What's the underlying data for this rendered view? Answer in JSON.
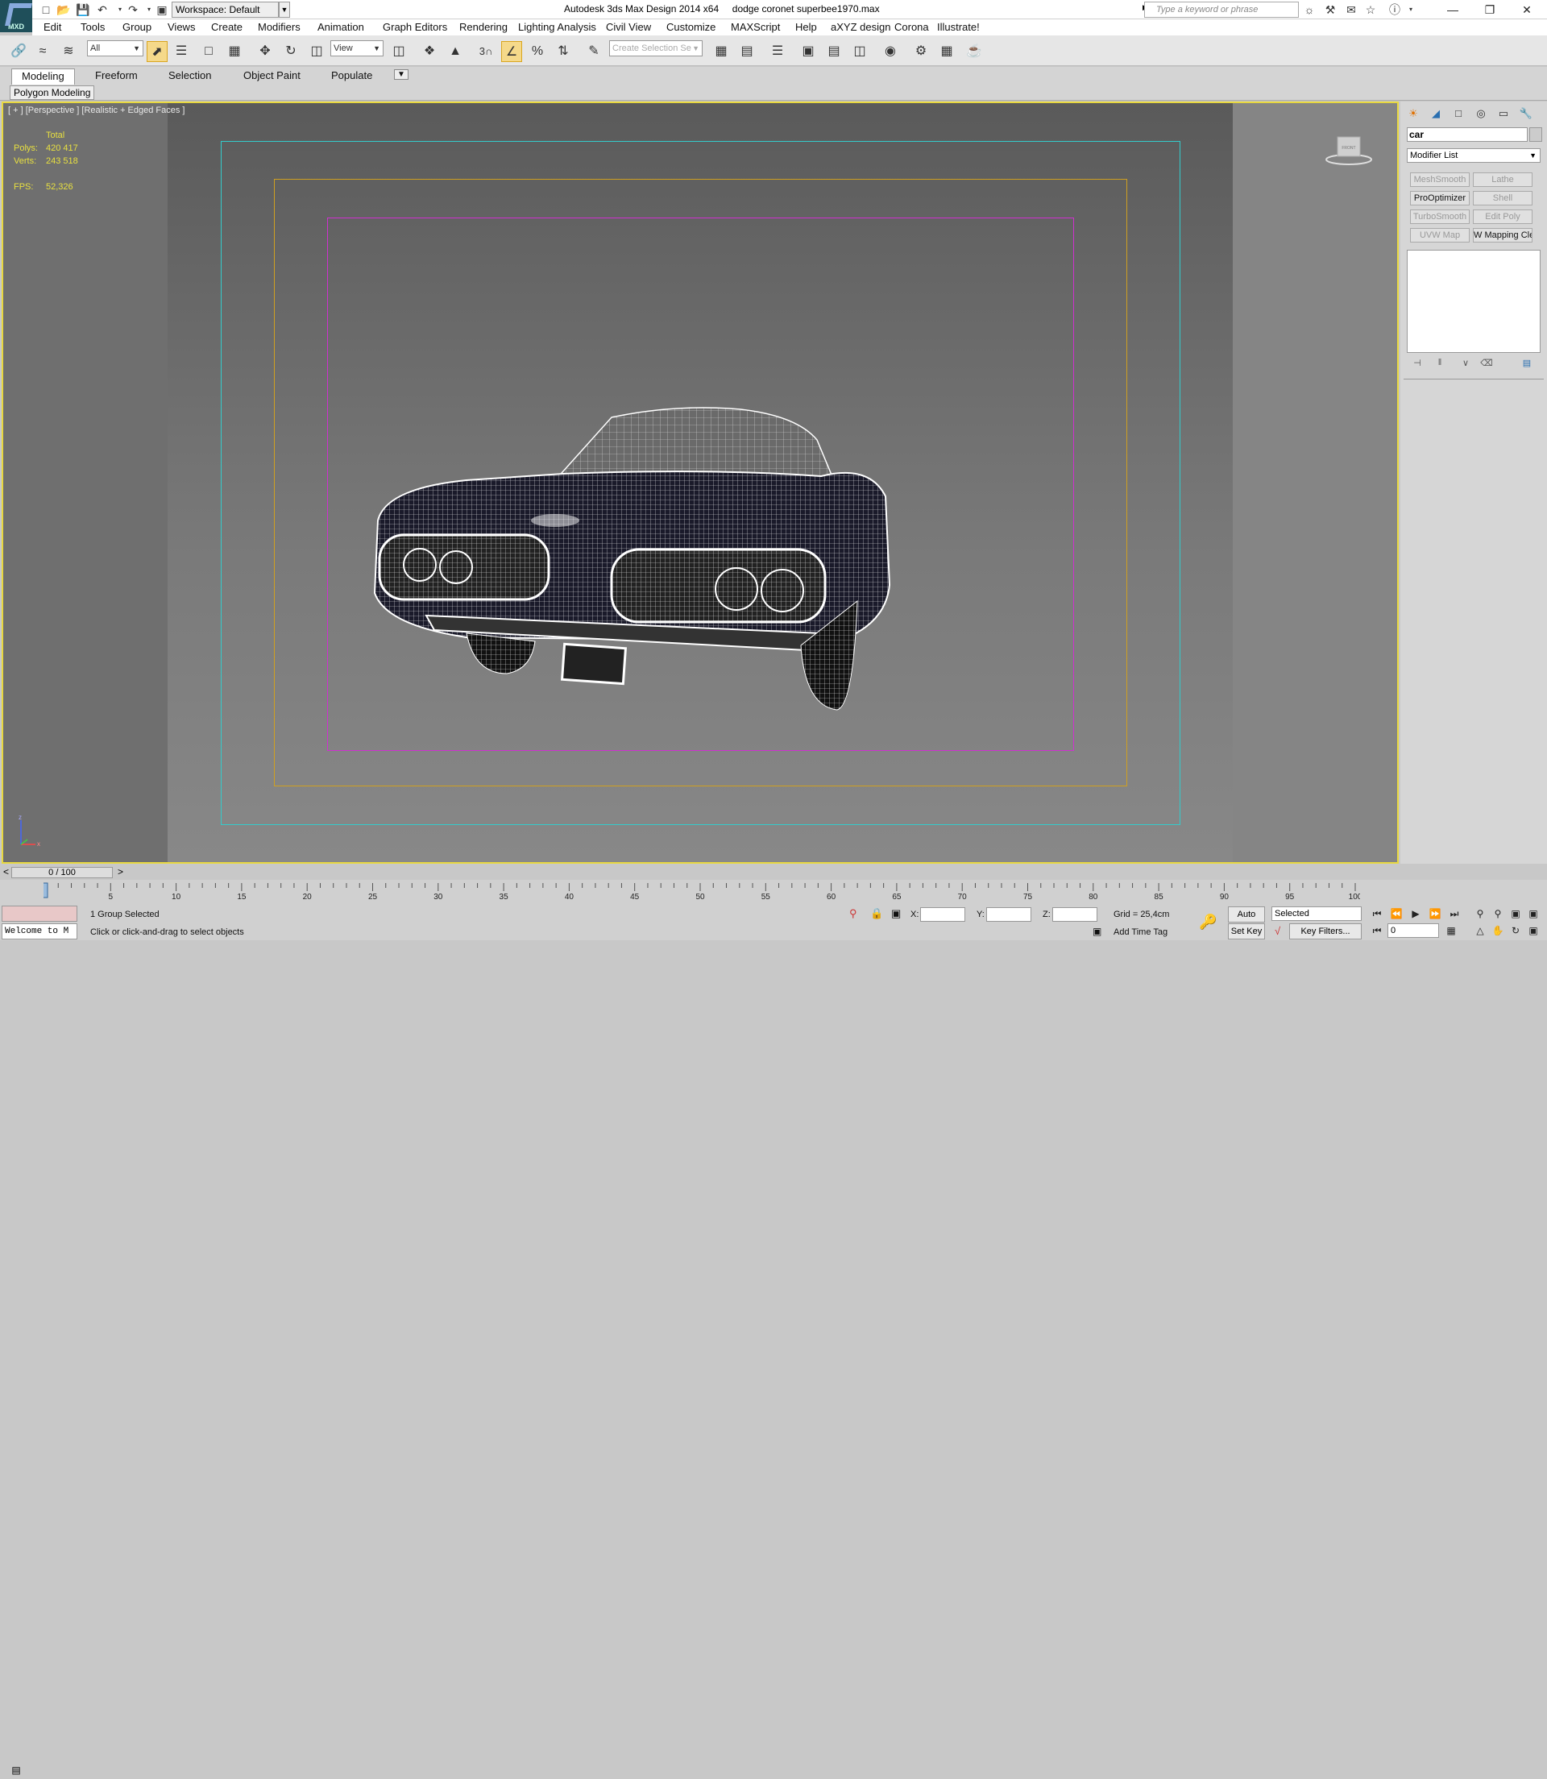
{
  "app": {
    "logo_text": "MXD",
    "title": "Autodesk 3ds Max Design 2014 x64     dodge coronet superbee1970.max",
    "workspace": "Workspace: Default",
    "search_placeholder": "Type a keyword or phrase"
  },
  "menu": [
    "Edit",
    "Tools",
    "Group",
    "Views",
    "Create",
    "Modifiers",
    "Animation",
    "Graph Editors",
    "Rendering",
    "Lighting Analysis",
    "Civil View",
    "Customize",
    "MAXScript",
    "Help",
    "aXYZ design",
    "Corona",
    "Illustrate!"
  ],
  "toolbar": {
    "selection_filter": "All",
    "ref_coord": "View",
    "named_selection_placeholder": "Create Selection Se",
    "snap_label": "3"
  },
  "ribbon": {
    "tabs": [
      "Modeling",
      "Freeform",
      "Selection",
      "Object Paint",
      "Populate"
    ],
    "active_tab": "Modeling",
    "panel": "Polygon Modeling"
  },
  "viewport": {
    "label": "[ + ] [Perspective ] [Realistic + Edged Faces ]",
    "stats_header": "Total",
    "polys_label": "Polys:",
    "polys_value": "420 417",
    "verts_label": "Verts:",
    "verts_value": "243 518",
    "fps_label": "FPS:",
    "fps_value": "52,326",
    "viewcube_label": "FRONT"
  },
  "command_panel": {
    "object_name": "car",
    "modifier_list": "Modifier List",
    "modifier_buttons": [
      {
        "label": "MeshSmooth",
        "enabled": false
      },
      {
        "label": "Lathe",
        "enabled": false
      },
      {
        "label": "ProOptimizer",
        "enabled": true
      },
      {
        "label": "Shell",
        "enabled": false
      },
      {
        "label": "TurboSmooth",
        "enabled": false
      },
      {
        "label": "Edit Poly",
        "enabled": false
      },
      {
        "label": "UVW Map",
        "enabled": false
      },
      {
        "label": "W Mapping Cle",
        "enabled": true
      }
    ]
  },
  "timeline": {
    "frame_display": "0 / 100",
    "prev": "<",
    "next": ">",
    "ticks": [
      "0",
      "5",
      "10",
      "15",
      "20",
      "25",
      "30",
      "35",
      "40",
      "45",
      "50",
      "55",
      "60",
      "65",
      "70",
      "75",
      "80",
      "85",
      "90",
      "95",
      "100"
    ]
  },
  "status": {
    "welcome": "Welcome to M",
    "selection": "1 Group Selected",
    "prompt": "Click or click-and-drag to select objects",
    "x_label": "X:",
    "y_label": "Y:",
    "z_label": "Z:",
    "grid": "Grid = 25,4cm",
    "add_time_tag": "Add Time Tag",
    "auto_key": "Auto Key",
    "set_key": "Set Key",
    "selected_dropdown": "Selected",
    "key_filters": "Key Filters...",
    "current_frame": "0"
  }
}
